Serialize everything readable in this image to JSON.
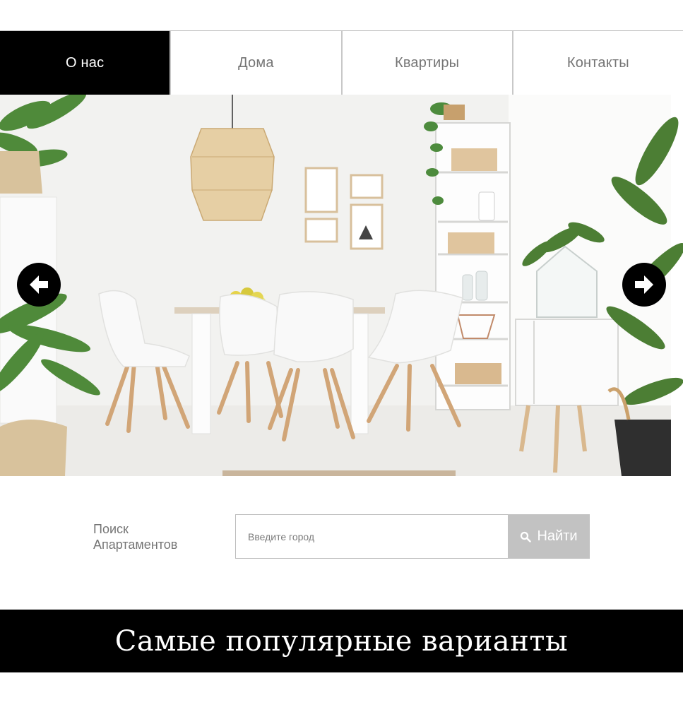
{
  "nav": {
    "items": [
      {
        "label": "О нас",
        "active": true
      },
      {
        "label": "Дома",
        "active": false
      },
      {
        "label": "Квартиры",
        "active": false
      },
      {
        "label": "Контакты",
        "active": false
      }
    ]
  },
  "slider": {
    "image_description": "white dining room with chairs, table, shelves and plants",
    "prev_icon": "arrow-left-icon",
    "next_icon": "arrow-right-icon"
  },
  "search": {
    "label": "Поиск Апартаментов",
    "placeholder": "Введите город",
    "value": "",
    "button_label": "Найти",
    "button_icon": "search-icon"
  },
  "popular": {
    "title": "Самые популярные варианты"
  },
  "colors": {
    "nav_active_bg": "#000000",
    "nav_text": "#757575",
    "search_button_bg": "#c2c2c2",
    "banner_bg": "#000000"
  }
}
